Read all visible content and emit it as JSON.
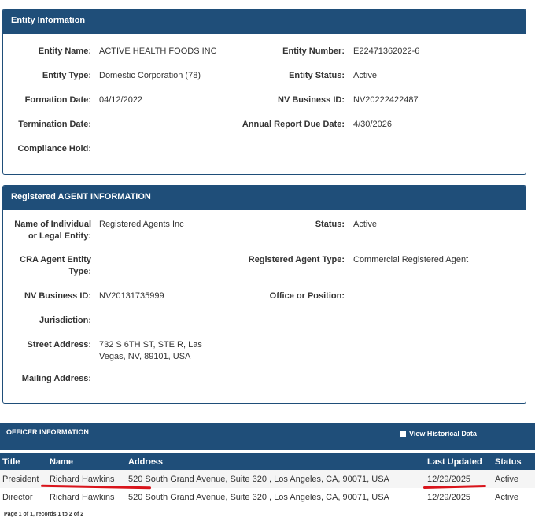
{
  "entity": {
    "header": "Entity Information",
    "fields": {
      "entity_name_label": "Entity Name:",
      "entity_name": "ACTIVE HEALTH FOODS INC",
      "entity_number_label": "Entity Number:",
      "entity_number": "E22471362022-6",
      "entity_type_label": "Entity Type:",
      "entity_type": "Domestic Corporation (78)",
      "entity_status_label": "Entity Status:",
      "entity_status": "Active",
      "formation_date_label": "Formation Date:",
      "formation_date": "04/12/2022",
      "nv_business_id_label": "NV Business ID:",
      "nv_business_id": "NV20222422487",
      "termination_date_label": "Termination Date:",
      "termination_date": "",
      "annual_report_label": "Annual Report Due Date:",
      "annual_report": "4/30/2026",
      "compliance_hold_label": "Compliance Hold:",
      "compliance_hold": ""
    }
  },
  "agent": {
    "header": "Registered AGENT INFORMATION",
    "fields": {
      "name_label_1": "Name of Individual",
      "name_label_2": "or Legal Entity:",
      "name": "Registered Agents Inc",
      "status_label": "Status:",
      "status": "Active",
      "cra_label_1": "CRA Agent Entity",
      "cra_label_2": "Type:",
      "cra": "",
      "agent_type_label": "Registered Agent Type:",
      "agent_type": "Commercial Registered Agent",
      "nv_business_id_label": "NV Business ID:",
      "nv_business_id": "NV20131735999",
      "office_label": "Office or Position:",
      "office": "",
      "jurisdiction_label": "Jurisdiction:",
      "jurisdiction": "",
      "street_label": "Street Address:",
      "street_1": "732 S 6TH ST, STE R, Las",
      "street_2": "Vegas, NV, 89101, USA",
      "mailing_label": "Mailing Address:",
      "mailing": ""
    }
  },
  "officers": {
    "header": "OFFICER INFORMATION",
    "view_historical": "View Historical Data",
    "columns": [
      "Title",
      "Name",
      "Address",
      "Last Updated",
      "Status"
    ],
    "rows": [
      [
        "President",
        "Richard Hawkins",
        "520 South Grand Avenue, Suite 320 , Los Angeles, CA, 90071, USA",
        "12/29/2025",
        "Active"
      ],
      [
        "Director",
        "Richard Hawkins",
        "520 South Grand Avenue, Suite 320 , Los Angeles, CA, 90071, USA",
        "12/29/2025",
        "Active"
      ]
    ],
    "pager": "Page 1 of 1, records 1 to 2 of 2"
  },
  "colors": {
    "header_bg": "#1f4e79",
    "annotation_red": "#d9141b"
  }
}
